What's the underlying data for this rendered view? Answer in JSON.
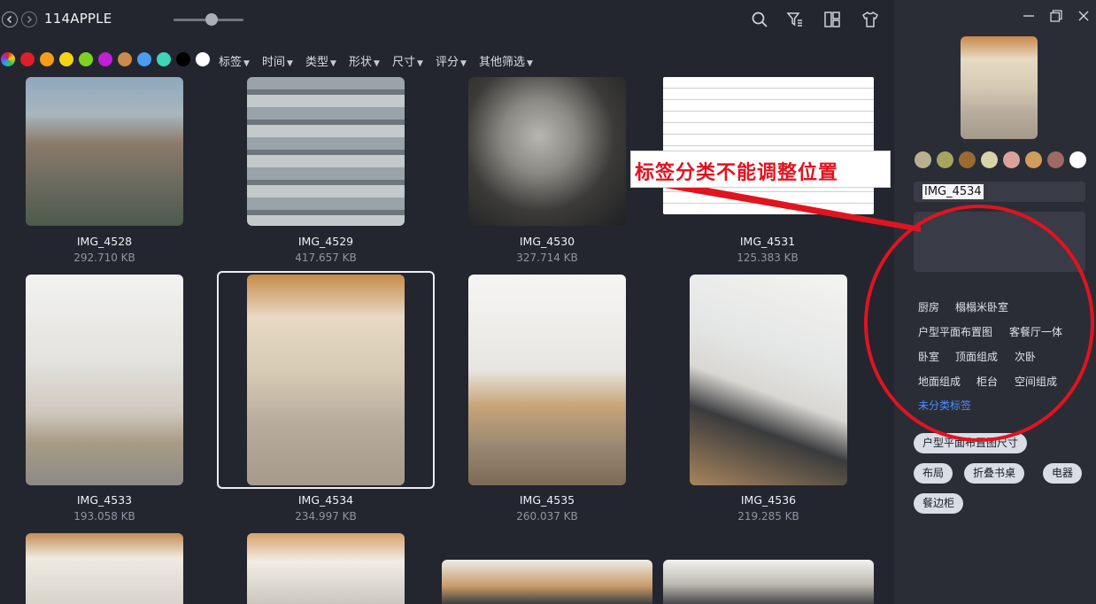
{
  "window": {
    "title": "114APPLE"
  },
  "filters": {
    "swatch_colors": [
      "#e01d2b",
      "#f59c1a",
      "#f7d316",
      "#7ed321",
      "#c01fd3",
      "#c98a4e",
      "#4a9cf0",
      "#3ed6b8",
      "#000000",
      "#ffffff"
    ],
    "items": [
      {
        "label": "标签"
      },
      {
        "label": "时间"
      },
      {
        "label": "类型"
      },
      {
        "label": "形状"
      },
      {
        "label": "尺寸"
      },
      {
        "label": "评分"
      },
      {
        "label": "其他筛选"
      }
    ]
  },
  "grid": {
    "items": [
      {
        "name": "IMG_4528",
        "size": "292.710 KB"
      },
      {
        "name": "IMG_4529",
        "size": "417.657 KB"
      },
      {
        "name": "IMG_4530",
        "size": "327.714 KB"
      },
      {
        "name": "IMG_4531",
        "size": "125.383 KB"
      },
      {
        "name": "IMG_4533",
        "size": "193.058 KB"
      },
      {
        "name": "IMG_4534",
        "size": "234.997 KB"
      },
      {
        "name": "IMG_4535",
        "size": "260.037 KB"
      },
      {
        "name": "IMG_4536",
        "size": "219.285 KB"
      }
    ],
    "selected": "IMG_4534"
  },
  "annotation": {
    "text": "标签分类不能调整位置",
    "color": "#e0141f"
  },
  "panel": {
    "palette": [
      "#b8b18e",
      "#a5a55e",
      "#9a6a32",
      "#d8d4a8",
      "#d9a39c",
      "#d29c5c",
      "#9e6a64",
      "#ffffff"
    ],
    "filename": "IMG_4534",
    "tag_groups": [
      [
        "厨房",
        "榻榻米卧室"
      ],
      [
        "户型平面布置图",
        "客餐厅一体"
      ],
      [
        "卧室",
        "顶面组成",
        "次卧"
      ],
      [
        "地面组成",
        "柜台",
        "空间组成"
      ]
    ],
    "unclassified_label": "未分类标签",
    "tags": [
      "户型平面布置图尺寸",
      "布局",
      "折叠书桌",
      "电器",
      "餐边柜"
    ]
  }
}
